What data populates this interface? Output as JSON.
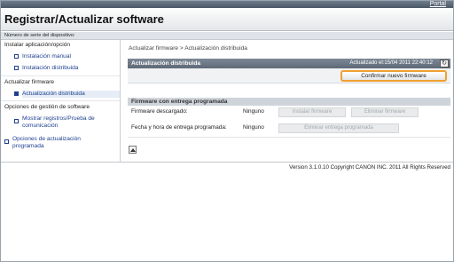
{
  "header": {
    "portal_link": "Portal",
    "title": "Registrar/Actualizar software",
    "serial_label": "Número de serie del dispositivo:"
  },
  "sidebar": {
    "sections": [
      {
        "heading": "Instalar aplicación/opción",
        "items": [
          {
            "label": "Instalación manual"
          },
          {
            "label": "Instalación distribuida"
          }
        ]
      },
      {
        "heading": "Actualizar firmware",
        "items": [
          {
            "label": "Actualización distribuida"
          }
        ]
      },
      {
        "heading": "Opciones de gestión de software",
        "items": [
          {
            "label": "Mostrar registros/Prueba de",
            "label2": "comunicación"
          },
          {
            "label": "Opciones de actualización",
            "label2": "programada"
          }
        ]
      }
    ]
  },
  "main": {
    "breadcrumb": "Actualizar firmware > Actualización distribuida",
    "panel": {
      "title": "Actualización distribuida",
      "updated": "Actualizado el:15/04 2011 22:40:12",
      "refresh_icon": "refresh-icon",
      "confirm_button": "Confirmar nuevo firmware"
    },
    "scheduled": {
      "title": "Firmware con entrega programada",
      "downloaded_label": "Firmware descargado:",
      "downloaded_value": "Ninguno",
      "install_button": "Instalar firmware",
      "delete_button": "Eliminar firmware",
      "datetime_label": "Fecha y hora de entrega programada:",
      "datetime_value": "Ninguno",
      "delete_schedule_button": "Eliminar entrega programada"
    }
  },
  "footer": {
    "version": "Version 3.1.0.10 Copyright CANON INC. 2011 All Rights Reserved"
  },
  "colors": {
    "highlight_border": "#f0a030",
    "panel_header": "#5e6977",
    "link": "#1d3f8f"
  }
}
